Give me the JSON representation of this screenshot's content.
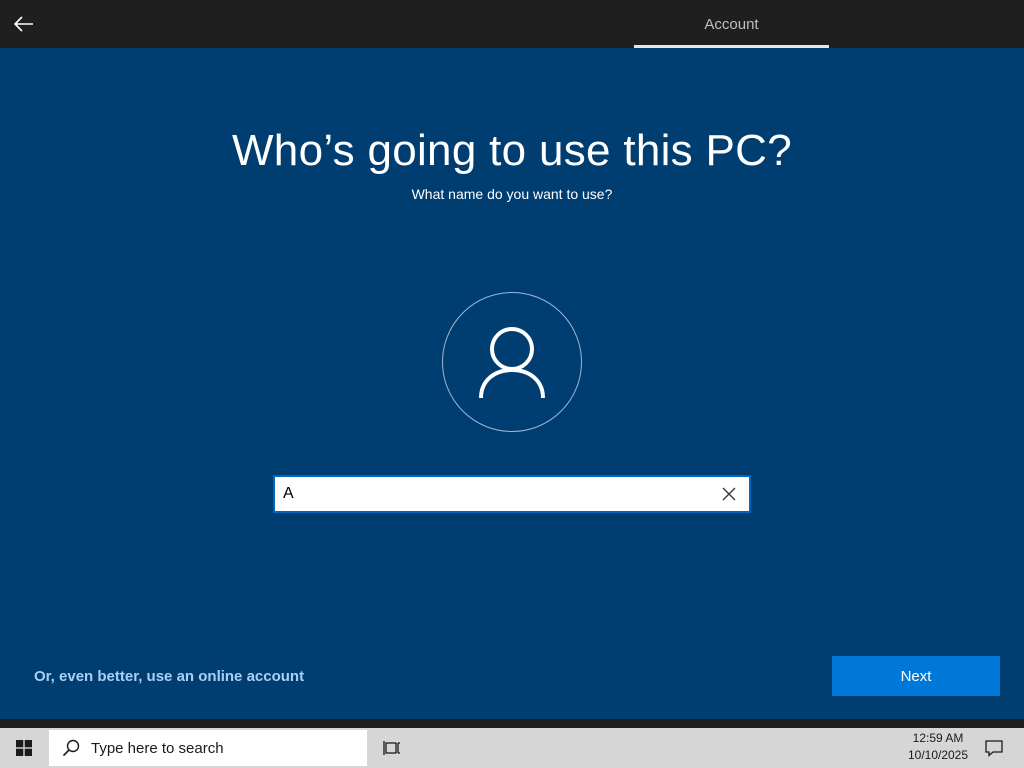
{
  "header": {
    "step_label": "Account"
  },
  "main": {
    "title": "Who’s going to use this PC?",
    "subtitle": "What name do you want to use?",
    "name_input_value": "A",
    "online_account_link": "Or, even better, use an online account",
    "next_label": "Next"
  },
  "taskbar": {
    "search_placeholder": "Type here to search",
    "time": "12:59 AM",
    "date": "10/10/2025"
  },
  "colors": {
    "background": "#003e72",
    "accent": "#0078d7",
    "topbar": "#1f1f1f",
    "taskbar": "#d6d6d6"
  },
  "icons": {
    "back": "back-arrow-icon",
    "avatar": "user-icon",
    "clear": "close-icon",
    "start": "windows-logo-icon",
    "search": "search-icon",
    "taskview": "task-view-icon",
    "notifications": "action-center-icon"
  }
}
